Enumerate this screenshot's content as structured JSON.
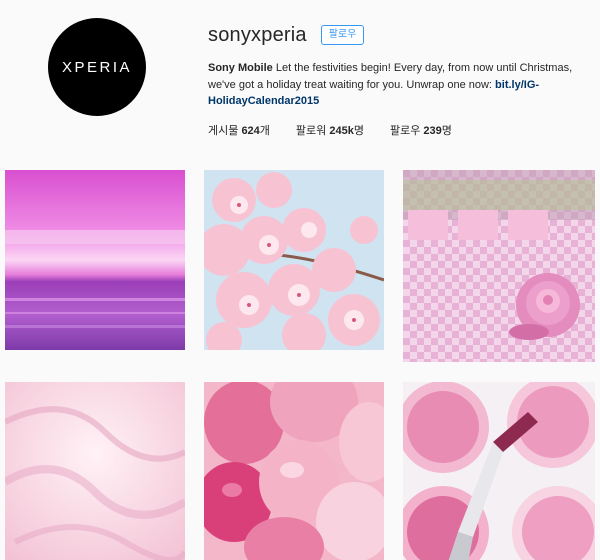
{
  "profile": {
    "avatar_text": "XPERIA",
    "username": "sonyxperia",
    "follow_label": "팔로우",
    "full_name": "Sony Mobile",
    "bio_text": " Let the festivities begin! Every day, from now until Christmas, we've got a holiday treat waiting for you. Unwrap one now: ",
    "bio_link": "bit.ly/IG-HolidayCalendar2015",
    "stats": [
      {
        "label": "게시물",
        "count": "624",
        "suffix": "개"
      },
      {
        "label": "팔로워",
        "count": "245k",
        "suffix": "명"
      },
      {
        "label": "팔로우",
        "count": "239",
        "suffix": "명"
      }
    ]
  },
  "posts": [
    {
      "subject": "pink-sunset-sea"
    },
    {
      "subject": "cherry-blossoms"
    },
    {
      "subject": "pink-rose-candy"
    },
    {
      "subject": "pink-cream-swirl"
    },
    {
      "subject": "pink-balloons"
    },
    {
      "subject": "pink-blush-palette-brush"
    }
  ],
  "colors": {
    "accent": "#3897f0",
    "link": "#003569",
    "background": "#fafafa"
  }
}
